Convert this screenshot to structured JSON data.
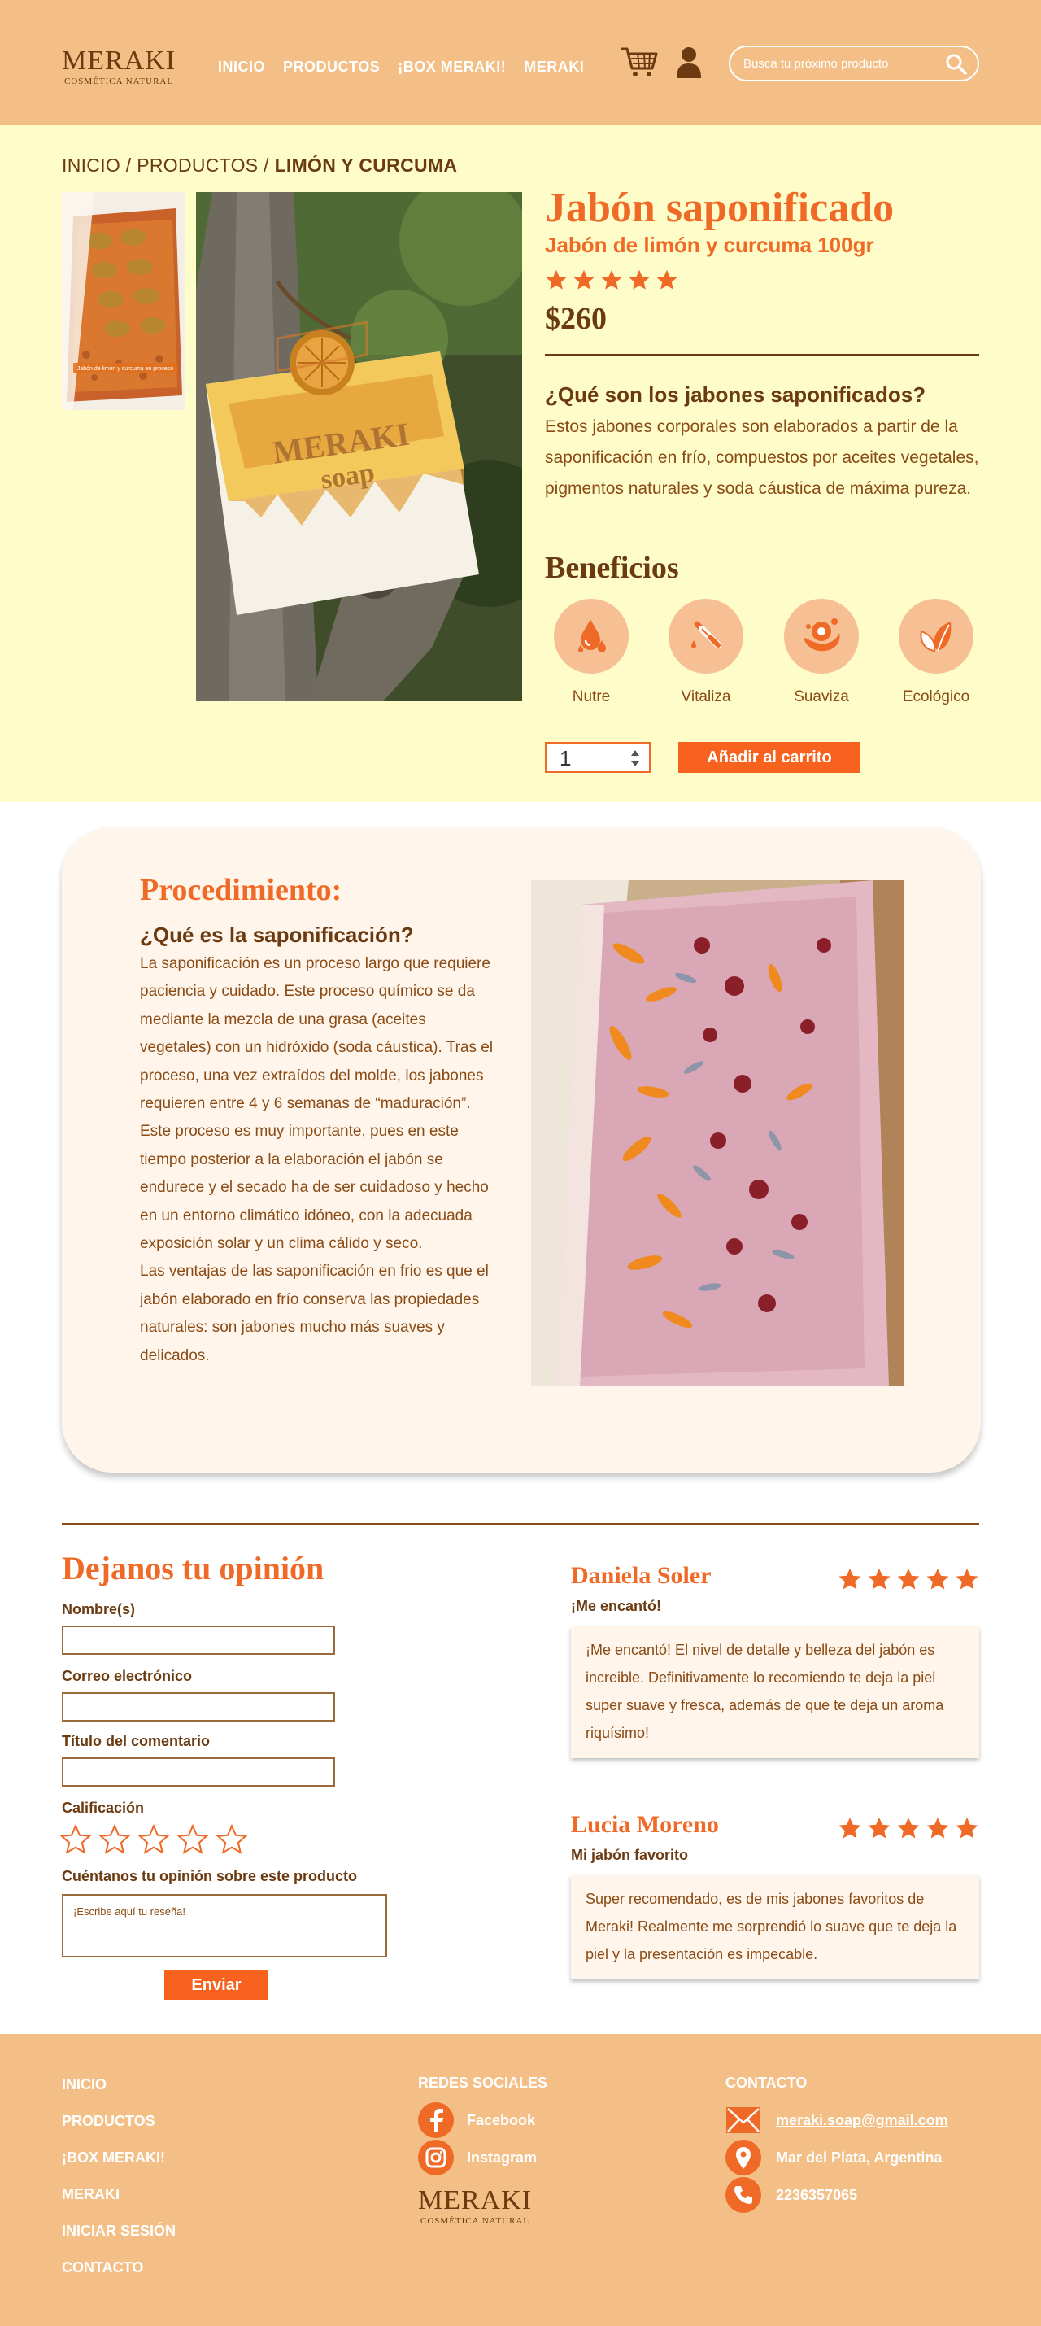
{
  "header": {
    "logo_brand": "MERAKI",
    "logo_sub": "COSMÉTICA NATURAL",
    "nav": [
      "INICIO",
      "PRODUCTOS",
      "¡BOX MERAKI!",
      "MERAKI"
    ],
    "search_placeholder": "Busca tu próximo producto"
  },
  "breadcrumb": {
    "parts": [
      "INICIO",
      "PRODUCTOS"
    ],
    "separator": "/",
    "current": "LIMÓN Y CURCUMA"
  },
  "product": {
    "thumb_caption": "Jabón de limón y curcuma en proceso",
    "title": "Jabón saponificado",
    "subtitle": "Jabón de limón y curcuma 100gr",
    "rating": 5,
    "price": "$260",
    "question": "¿Qué son los jabones saponificados?",
    "description": "Estos jabones corporales son elaborados a partir de la saponificación en frío, compuestos por aceites vegetales, pigmentos naturales y soda cáustica de máxima pureza.",
    "benefits_title": "Beneficios",
    "benefits": [
      {
        "label": "Nutre",
        "icon": "drops-icon"
      },
      {
        "label": "Vitaliza",
        "icon": "dropper-icon"
      },
      {
        "label": "Suaviza",
        "icon": "splash-icon"
      },
      {
        "label": "Ecológico",
        "icon": "leaf-icon"
      }
    ],
    "quantity": "1",
    "add_to_cart": "Añadir al carrito"
  },
  "procedure": {
    "title": "Procedimiento:",
    "question": "¿Qué es la saponificación?",
    "paragraph1": "La saponificación es un proceso largo que requiere paciencia y cuidado. Este proceso químico se da mediante la mezcla de una grasa (aceites vegetales) con un hidróxido (soda cáustica). Tras el proceso, una vez extraídos del molde, los jabones requieren entre 4 y 6 semanas de “maduración”. Este proceso es muy importante, pues en este tiempo posterior a la elaboración el jabón se endurece y el secado ha de ser cuidadoso y hecho en un entorno climático idóneo, con la adecuada exposición solar y un clima cálido y seco.",
    "paragraph2": "Las ventajas de las saponificación en frio es que el jabón elaborado en frío conserva las propiedades naturales: son jabones mucho más suaves y delicados."
  },
  "review_form": {
    "title": "Dejanos tu opinión",
    "name_label": "Nombre(s)",
    "email_label": "Correo electrónico",
    "subject_label": "Título del comentario",
    "rating_label": "Calificación",
    "rating_value": 0,
    "rating_max": 5,
    "opinion_label": "Cuéntanos tu opinión sobre este producto",
    "opinion_placeholder": "¡Escribe aquí tu reseña!",
    "submit": "Enviar"
  },
  "reviews": [
    {
      "name": "Daniela Soler",
      "rating": 5,
      "title": "¡Me encantó!",
      "body": "¡Me encantó! El nivel de detalle y belleza del jabón es increible. Definitivamente lo recomiendo te deja la piel super suave y fresca, además de que te deja un aroma riquísimo!"
    },
    {
      "name": "Lucia Moreno",
      "rating": 5,
      "title": "Mi jabón favorito",
      "body": "Super recomendado, es de mis jabones favoritos de Meraki! Realmente me  sorprendió lo suave que te deja la piel y la presentación es impecable."
    }
  ],
  "footer": {
    "links": [
      "INICIO",
      "PRODUCTOS",
      "¡BOX MERAKI!",
      "MERAKI",
      "INICIAR SESIÓN",
      "CONTACTO"
    ],
    "social_title": "REDES SOCIALES",
    "social": [
      "Facebook",
      "Instagram"
    ],
    "contact_title": "CONTACTO",
    "email": "meraki.soap@gmail.com",
    "location": "Mar del Plata, Argentina",
    "phone": "2236357065",
    "logo_brand": "MERAKI",
    "logo_sub": "COSMÉTICA NATURAL"
  },
  "colors": {
    "header_bg": "#f3bf86",
    "product_bg": "#fefcc9",
    "accent": "#f06a27",
    "brown": "#6b3a10",
    "card_bg": "#fff5ea"
  }
}
